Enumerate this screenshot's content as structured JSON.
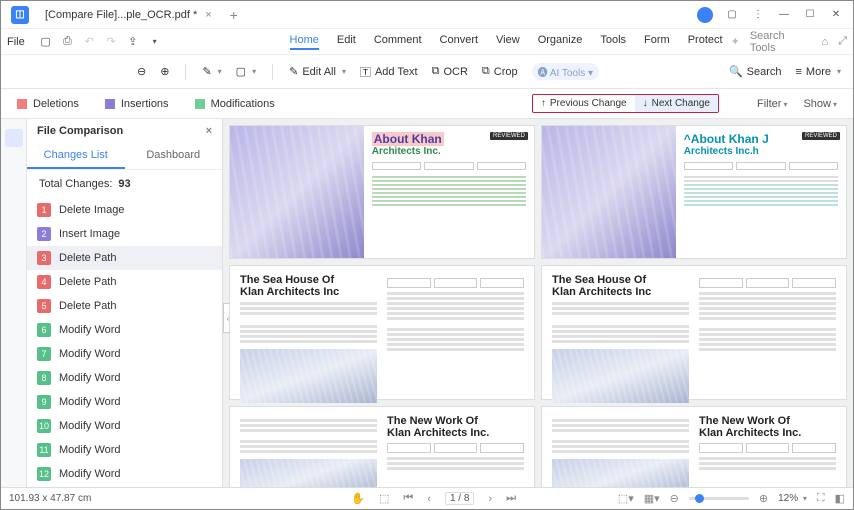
{
  "titlebar": {
    "tab_label": "[Compare File]...ple_OCR.pdf *"
  },
  "menubar": {
    "file": "File",
    "tabs": [
      "Home",
      "Edit",
      "Comment",
      "Convert",
      "View",
      "Organize",
      "Tools",
      "Form",
      "Protect"
    ],
    "search_tools": "Search Tools"
  },
  "toolbar": {
    "edit_all": "Edit All",
    "add_text": "Add Text",
    "ocr": "OCR",
    "crop": "Crop",
    "ai_tools": "AI Tools",
    "search": "Search",
    "more": "More"
  },
  "legend": {
    "deletions": "Deletions",
    "insertions": "Insertions",
    "modifications": "Modifications",
    "previous": "Previous Change",
    "next": "Next Change",
    "filter": "Filter",
    "show": "Show"
  },
  "sidepanel": {
    "header": "File Comparison",
    "tab_changes": "Changes List",
    "tab_dashboard": "Dashboard",
    "total_label": "Total Changes:",
    "total_value": "93",
    "items": [
      {
        "n": "1",
        "type": "del",
        "label": "Delete Image"
      },
      {
        "n": "2",
        "type": "ins",
        "label": "Insert Image"
      },
      {
        "n": "3",
        "type": "del",
        "label": "Delete Path"
      },
      {
        "n": "4",
        "type": "del",
        "label": "Delete Path"
      },
      {
        "n": "5",
        "type": "del",
        "label": "Delete Path"
      },
      {
        "n": "6",
        "type": "mod",
        "label": "Modify Word"
      },
      {
        "n": "7",
        "type": "mod",
        "label": "Modify Word"
      },
      {
        "n": "8",
        "type": "mod",
        "label": "Modify Word"
      },
      {
        "n": "9",
        "type": "mod",
        "label": "Modify Word"
      },
      {
        "n": "10",
        "type": "mod",
        "label": "Modify Word"
      },
      {
        "n": "11",
        "type": "mod",
        "label": "Modify Word"
      },
      {
        "n": "12",
        "type": "mod",
        "label": "Modify Word"
      }
    ]
  },
  "pages": {
    "hero_left": {
      "title": "About Khan",
      "sub": "Architects Inc."
    },
    "hero_right": {
      "title": "^About Khan J",
      "sub": "Architects Inc.h"
    },
    "doc1": {
      "title_a": "The Sea House Of",
      "title_b": "Klan Architects Inc"
    },
    "doc2": {
      "title_a": "The New Work Of",
      "title_b": "Klan Architects Inc."
    },
    "reviewed": "REVIEWED"
  },
  "status": {
    "coords": "101.93 x 47.87 cm",
    "page": "1 / 8",
    "zoom": "12%"
  }
}
